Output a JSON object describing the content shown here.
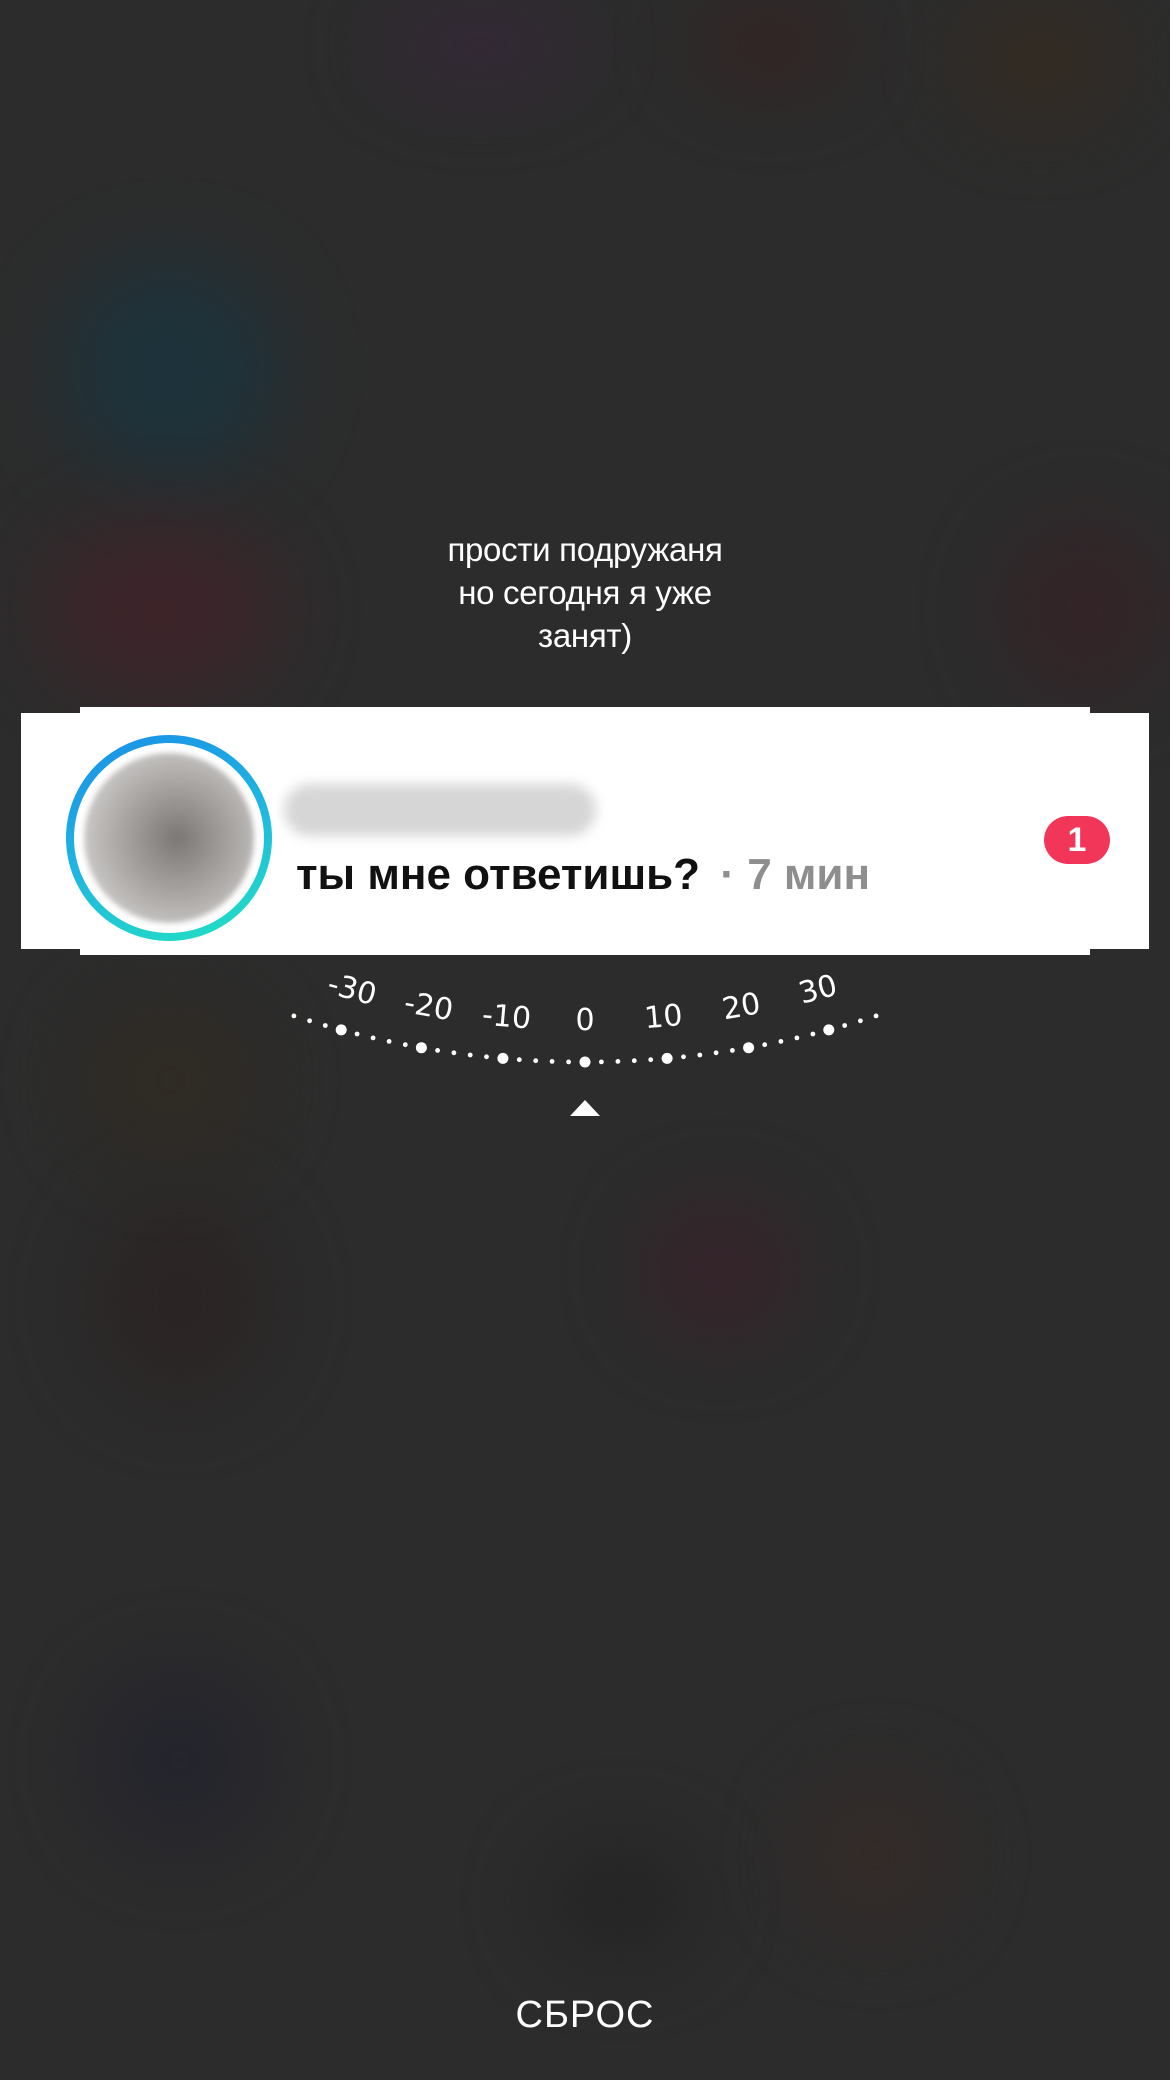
{
  "caption": {
    "lines": [
      "прости подружаня",
      "но сегодня я уже",
      "занят)"
    ]
  },
  "notification": {
    "avatar": "blurred-profile-photo",
    "username": "",
    "message": "ты мне ответишь?",
    "separator": "·",
    "time": "7 мин",
    "badge_count": "1",
    "badge_color": "#f2365a",
    "ring_colors": [
      "#1a8ee8",
      "#22e3c0"
    ]
  },
  "rotation_dial": {
    "labels": [
      "-30",
      "-20",
      "-10",
      "0",
      "10",
      "20",
      "30"
    ],
    "current_value": "0",
    "indicator": "triangle-up-icon"
  },
  "footer": {
    "reset_label": "СБРОС"
  }
}
